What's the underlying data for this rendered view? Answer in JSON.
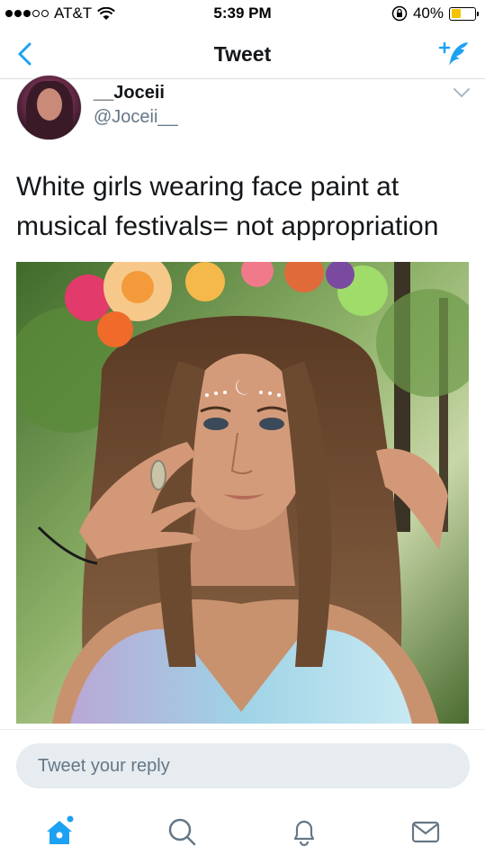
{
  "status_bar": {
    "carrier": "AT&T",
    "time": "5:39 PM",
    "battery_percent": "40%",
    "battery_level": 0.4,
    "icons": [
      "signal-dots-icon",
      "wifi-icon",
      "rotation-lock-icon",
      "battery-icon"
    ]
  },
  "nav": {
    "title": "Tweet",
    "back_icon": "chevron-left-icon",
    "compose_icon": "compose-tweet-icon"
  },
  "tweet": {
    "display_name": "__Joceii",
    "handle": "@Joceii__",
    "text": "White girls wearing face paint at musical festivals= not appropriation",
    "menu_icon": "chevron-down-icon"
  },
  "reply": {
    "placeholder": "Tweet your reply"
  },
  "tabs": [
    {
      "name": "home",
      "icon": "home-icon",
      "active": true
    },
    {
      "name": "search",
      "icon": "search-icon",
      "active": false
    },
    {
      "name": "notifications",
      "icon": "bell-icon",
      "active": false
    },
    {
      "name": "messages",
      "icon": "envelope-icon",
      "active": false
    }
  ],
  "colors": {
    "accent": "#1da1f2",
    "text": "#14171a",
    "secondary_text": "#657786",
    "reply_bg": "#e6ecf0"
  }
}
